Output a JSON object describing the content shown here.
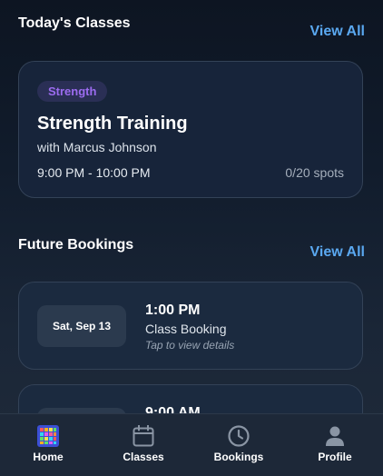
{
  "today": {
    "section_title": "Today's Classes",
    "view_all": "View All",
    "class": {
      "category": "Strength",
      "title": "Strength Training",
      "instructor": "with Marcus Johnson",
      "time": "9:00 PM - 10:00 PM",
      "spots": "0/20 spots"
    }
  },
  "future": {
    "section_title": "Future Bookings",
    "view_all": "View All",
    "bookings": [
      {
        "date": "Sat, Sep 13",
        "time": "1:00 PM",
        "type": "Class Booking",
        "hint": "Tap to view details"
      },
      {
        "time": "9:00 AM"
      }
    ]
  },
  "colors": {
    "accent": "#5aa8f0",
    "badge_text": "#9c6cf0",
    "badge_bg": "#2a2f55",
    "card_bg": "#17243a"
  },
  "tabs": [
    {
      "label": "Home",
      "icon": "home-grid-icon"
    },
    {
      "label": "Classes",
      "icon": "calendar-icon"
    },
    {
      "label": "Bookings",
      "icon": "clock-icon"
    },
    {
      "label": "Profile",
      "icon": "person-icon"
    }
  ]
}
